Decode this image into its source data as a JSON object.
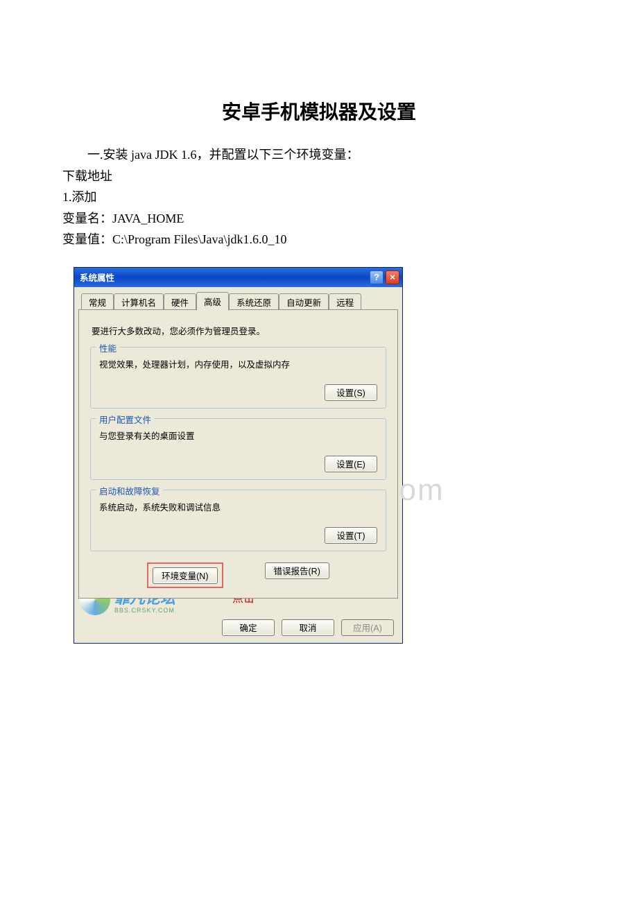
{
  "doc": {
    "title": "安卓手机模拟器及设置",
    "line1": "一.安装 java JDK 1.6，并配置以下三个环境变量：",
    "line2": "下载地址",
    "line3": "1.添加",
    "line4": "变量名：JAVA_HOME",
    "line5": "变量值：C:\\Program Files\\Java\\jdk1.6.0_10"
  },
  "dialog": {
    "title": "系统属性",
    "help_symbol": "?",
    "close_symbol": "×",
    "tabs": {
      "general": "常规",
      "computer_name": "计算机名",
      "hardware": "硬件",
      "advanced": "高级",
      "system_restore": "系统还原",
      "auto_update": "自动更新",
      "remote": "远程"
    },
    "admin_note": "要进行大多数改动，您必须作为管理员登录。",
    "groups": {
      "performance": {
        "legend": "性能",
        "desc": "视觉效果，处理器计划，内存使用，以及虚拟内存",
        "button": "设置(S)"
      },
      "user_profiles": {
        "legend": "用户配置文件",
        "desc": "与您登录有关的桌面设置",
        "button": "设置(E)"
      },
      "startup_recovery": {
        "legend": "启动和故障恢复",
        "desc": "系统启动，系统失败和调试信息",
        "button": "设置(T)"
      }
    },
    "env_vars_button": "环境变量(N)",
    "error_report_button": "错误报告(R)",
    "click_label": "点击",
    "ok": "确定",
    "cancel": "取消",
    "apply": "应用(A)"
  },
  "watermarks": {
    "bd": "www.bd    .com",
    "forum_text": "霏凡论坛",
    "forum_sub": "BBS.CRSKY.COM"
  }
}
